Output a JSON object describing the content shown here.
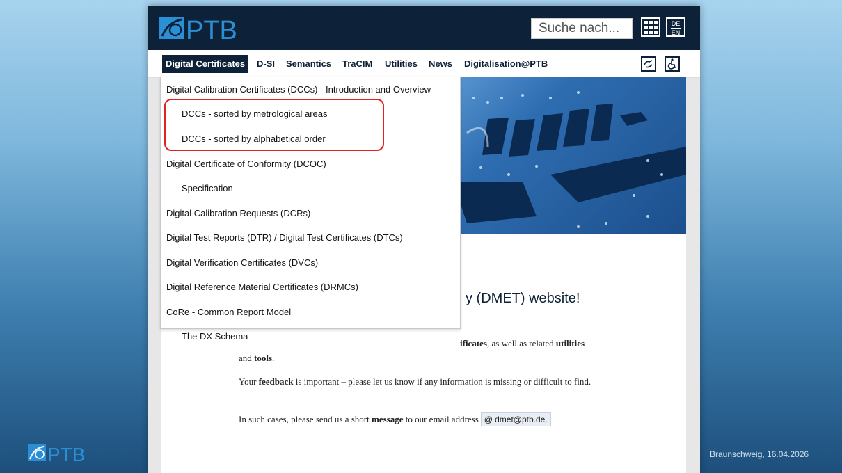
{
  "brand": {
    "name": "PTB"
  },
  "search": {
    "placeholder": "Suche nach..."
  },
  "header": {
    "lang_top": "DE",
    "lang_bottom": "EN"
  },
  "nav": {
    "items": [
      {
        "label": "Digital Certificates",
        "active": true
      },
      {
        "label": "D-SI"
      },
      {
        "label": "Semantics"
      },
      {
        "label": "TraCIM"
      },
      {
        "label": "Utilities"
      },
      {
        "label": "News"
      },
      {
        "label": "Digitalisation@PTB"
      }
    ]
  },
  "dropdown": {
    "items": [
      {
        "label": "Digital Calibration Certificates (DCCs) - Introduction and Overview",
        "indent": false
      },
      {
        "label": "DCCs - sorted by metrological areas",
        "indent": true
      },
      {
        "label": "DCCs - sorted by alphabetical order",
        "indent": true
      },
      {
        "label": "Digital Certificate of Conformity (DCOC)",
        "indent": false
      },
      {
        "label": "Specification",
        "indent": true
      },
      {
        "label": "Digital Calibration Requests (DCRs)",
        "indent": false
      },
      {
        "label": "Digital Test Reports (DTR) / Digital Test Certificates (DTCs)",
        "indent": false
      },
      {
        "label": "Digital Verification Certificates (DVCs)",
        "indent": false
      },
      {
        "label": "Digital Reference Material Certificates (DRMCs)",
        "indent": false
      },
      {
        "label": "CoRe - Common Report Model",
        "indent": false
      },
      {
        "label": "The DX Schema",
        "indent": true
      }
    ]
  },
  "page": {
    "heading_fragment": "y (DMET) website!",
    "p1_fragment_a": "ificates",
    "p1_fragment_b": ", as well as related ",
    "p1_fragment_c": "utilities",
    "p1_line2_a": "and ",
    "p1_line2_b": "tools",
    "p1_line2_c": ".",
    "p2_a": "Your ",
    "p2_b": "feedback",
    "p2_c": " is important – please let us know if any information is missing or difficult to find.",
    "p3_a": "In such cases, please send us a short ",
    "p3_b": "message",
    "p3_c": " to our email address",
    "email_at": "@",
    "email": "dmet@ptb.de."
  },
  "footer": {
    "text": "Braunschweig, 16.04.2026"
  },
  "colors": {
    "navy": "#0d2238",
    "highlight": "#e3231f"
  }
}
